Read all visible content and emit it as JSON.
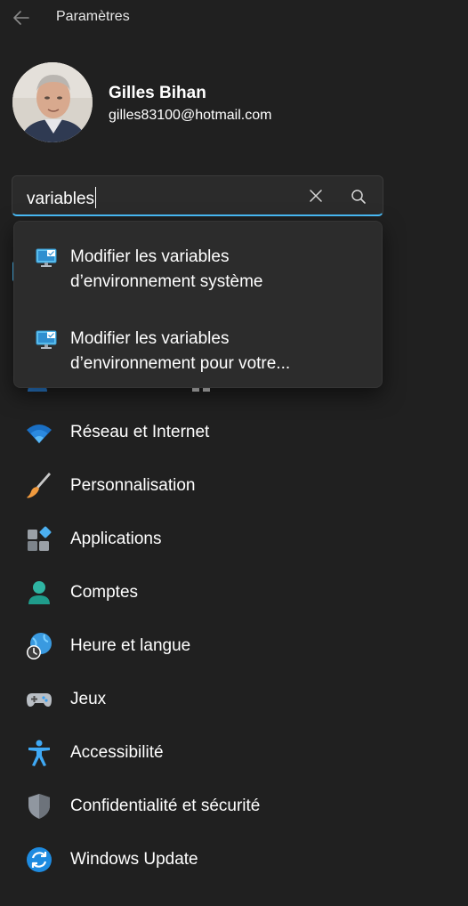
{
  "app": {
    "title": "Paramètres"
  },
  "profile": {
    "name": "Gilles Bihan",
    "email": "gilles83100@hotmail.com"
  },
  "search": {
    "value": "variables"
  },
  "suggestions": [
    {
      "line1": "Modifier les variables",
      "line2": "d’environnement système"
    },
    {
      "line1": "Modifier les variables",
      "line2": "d’environnement pour votre..."
    }
  ],
  "nav": [
    {
      "label": "Réseau et Internet",
      "icon": "wifi-icon"
    },
    {
      "label": "Personnalisation",
      "icon": "brush-icon"
    },
    {
      "label": "Applications",
      "icon": "apps-icon"
    },
    {
      "label": "Comptes",
      "icon": "account-icon"
    },
    {
      "label": "Heure et langue",
      "icon": "globe-clock-icon"
    },
    {
      "label": "Jeux",
      "icon": "gamepad-icon"
    },
    {
      "label": "Accessibilité",
      "icon": "accessibility-icon"
    },
    {
      "label": "Confidentialité et sécurité",
      "icon": "shield-icon"
    },
    {
      "label": "Windows Update",
      "icon": "update-icon"
    }
  ],
  "colors": {
    "accent": "#4cc2ff",
    "background": "#202020",
    "surface": "#2c2c2c"
  }
}
